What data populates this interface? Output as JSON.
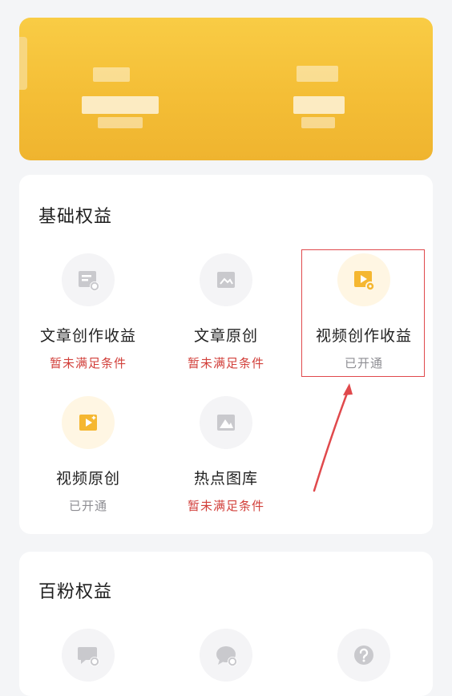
{
  "basic_section": {
    "title": "基础权益",
    "items": [
      {
        "label": "文章创作收益",
        "status": "暂未满足条件",
        "state": "unmet",
        "icon": "article-revenue-icon"
      },
      {
        "label": "文章原创",
        "status": "暂未满足条件",
        "state": "unmet",
        "icon": "article-original-icon"
      },
      {
        "label": "视频创作收益",
        "status": "已开通",
        "state": "enabled",
        "icon": "video-revenue-icon"
      },
      {
        "label": "视频原创",
        "status": "已开通",
        "state": "enabled",
        "icon": "video-original-icon"
      },
      {
        "label": "热点图库",
        "status": "暂未满足条件",
        "state": "unmet",
        "icon": "hot-gallery-icon"
      }
    ]
  },
  "hundred_fans_section": {
    "title": "百粉权益",
    "items": [
      {
        "icon": "comment-icon"
      },
      {
        "icon": "chat-icon"
      },
      {
        "icon": "question-icon"
      }
    ]
  },
  "colors": {
    "banner": "#f4be36",
    "accent": "#f5b731",
    "warn": "#d2403b",
    "muted": "#8e8e93",
    "highlight": "#e0494c"
  }
}
